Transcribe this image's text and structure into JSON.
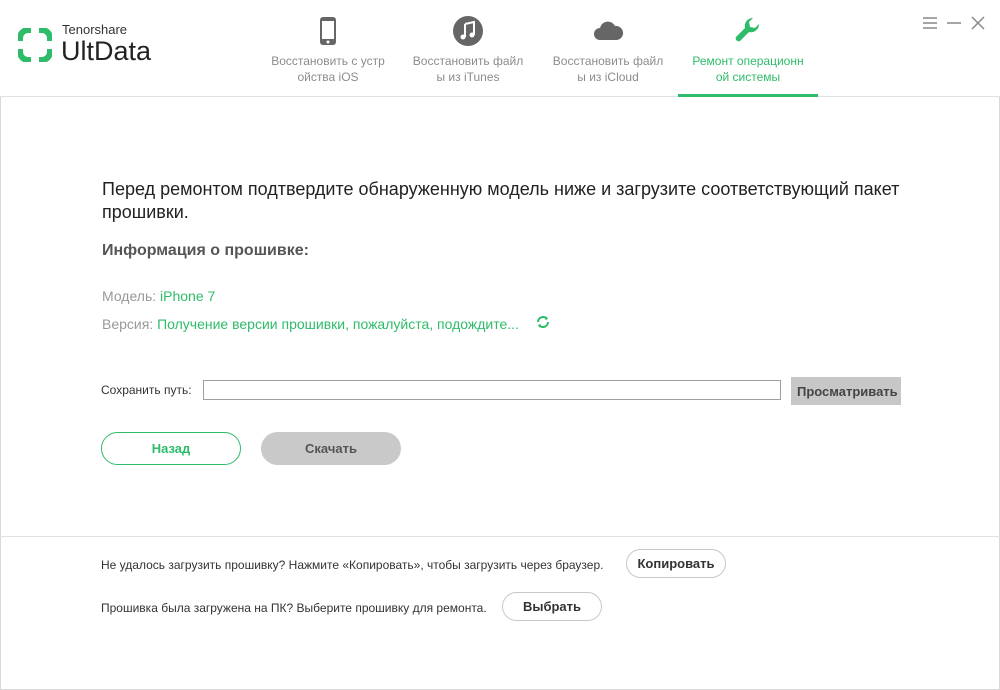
{
  "app": {
    "brand_small": "Tenorshare",
    "brand_big": "UltData",
    "accent_color": "#2fbc6a"
  },
  "tabs": [
    {
      "label": "Восстановить с устр\nойства iOS",
      "icon": "phone-icon",
      "active": false
    },
    {
      "label": "Восстановить файл\nы из iTunes",
      "icon": "music-note-icon",
      "active": false
    },
    {
      "label": "Восстановить файл\nы из iCloud",
      "icon": "cloud-icon",
      "active": false
    },
    {
      "label": "Ремонт операционн\nой системы",
      "icon": "wrench-icon",
      "active": true
    }
  ],
  "window_controls": [
    "menu-icon",
    "minimize-icon",
    "close-icon"
  ],
  "main": {
    "heading": "Перед ремонтом подтвердите обнаруженную модель ниже и загрузите соответствующий пакет прошивки.",
    "firmware_info_label": "Информация о прошивке:",
    "model_label": "Модель:",
    "model_value": "iPhone 7",
    "version_label": "Версия:",
    "version_value": "Получение версии прошивки, пожалуйста, подождите...",
    "save_path_label": "Сохранить путь:",
    "save_path_value": "",
    "browse_label": "Просматривать",
    "back_label": "Назад",
    "download_label": "Скачать"
  },
  "footer": {
    "copy_text": "Не удалось загрузить прошивку? Нажмите «Копировать», чтобы загрузить через браузер.",
    "copy_button": "Копировать",
    "select_text": "Прошивка была загружена на ПК? Выберите прошивку для ремонта.",
    "select_button": "Выбрать"
  }
}
